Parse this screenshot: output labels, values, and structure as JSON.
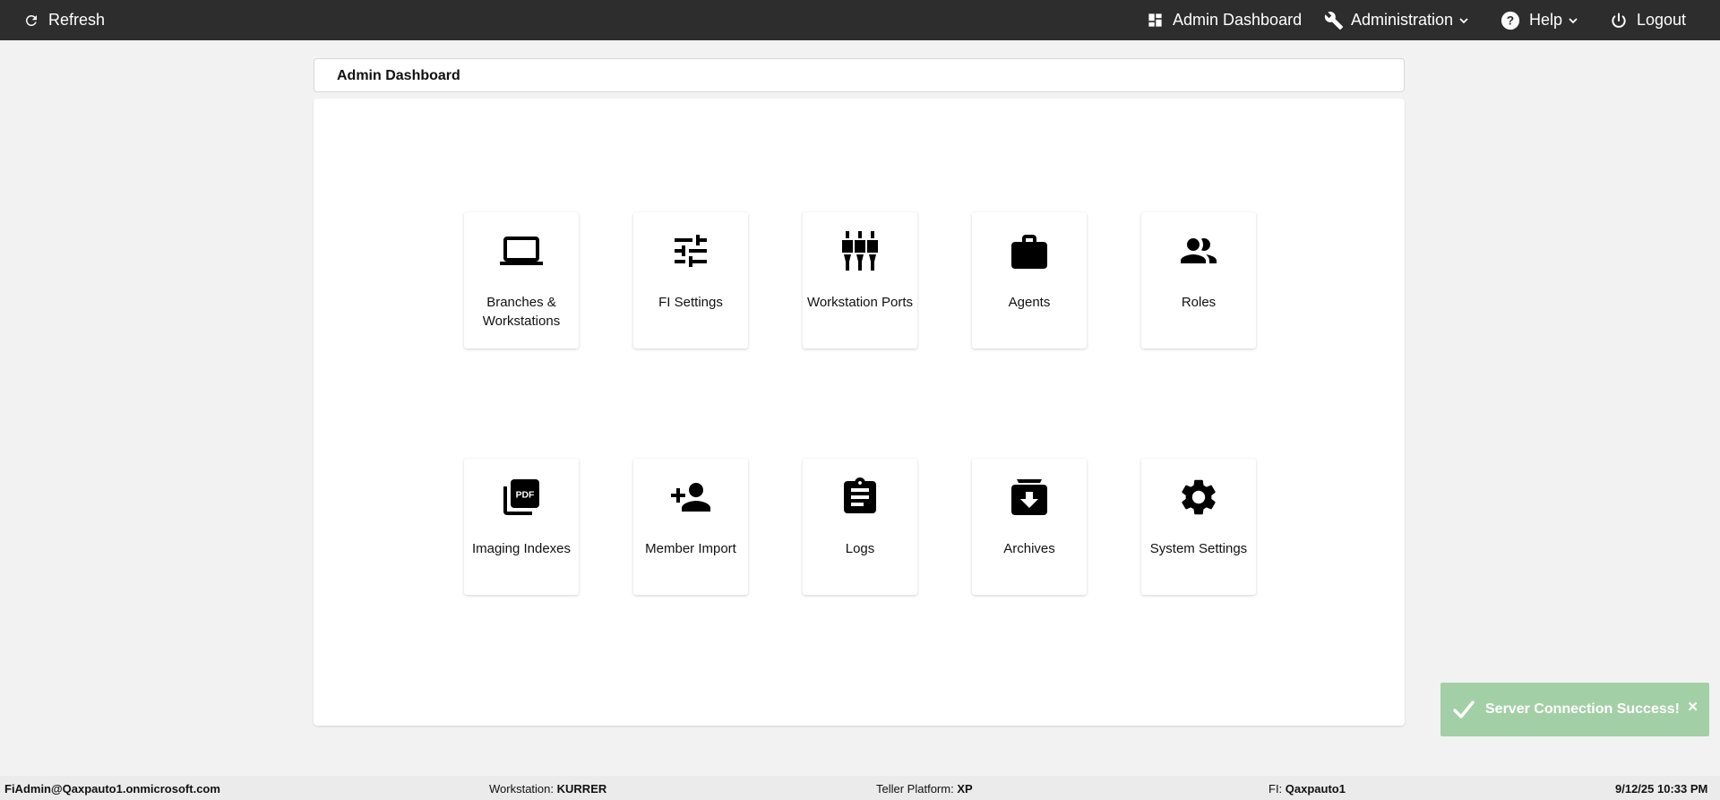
{
  "topbar": {
    "refresh_label": "Refresh",
    "nav": {
      "dashboard_label": "Admin Dashboard",
      "administration_label": "Administration",
      "help_label": "Help",
      "logout_label": "Logout"
    }
  },
  "page": {
    "title": "Admin Dashboard"
  },
  "tiles": [
    {
      "label": "Branches & Workstations",
      "icon": "laptop-icon"
    },
    {
      "label": "FI Settings",
      "icon": "sliders-icon"
    },
    {
      "label": "Workstation Ports",
      "icon": "ports-icon"
    },
    {
      "label": "Agents",
      "icon": "briefcase-icon"
    },
    {
      "label": "Roles",
      "icon": "people-icon"
    },
    {
      "label": "Imaging Indexes",
      "icon": "pdf-icon"
    },
    {
      "label": "Member Import",
      "icon": "add-person-icon"
    },
    {
      "label": "Logs",
      "icon": "clipboard-icon"
    },
    {
      "label": "Archives",
      "icon": "archive-icon"
    },
    {
      "label": "System Settings",
      "icon": "gear-icon"
    }
  ],
  "toast": {
    "message": "Server Connection Success!",
    "close_symbol": "×",
    "color": "#a3cfa7"
  },
  "statusbar": {
    "user": "FiAdmin@Qaxpauto1.onmicrosoft.com",
    "workstation_label": "Workstation:",
    "workstation_value": "KURRER",
    "teller_label": "Teller Platform:",
    "teller_value": "XP",
    "fi_label": "FI:",
    "fi_value": "Qaxpauto1",
    "datetime": "9/12/25 10:33 PM"
  },
  "colors": {
    "topbar": "#2d2d2d",
    "background": "#f2f2f2",
    "panel": "#ffffff"
  }
}
